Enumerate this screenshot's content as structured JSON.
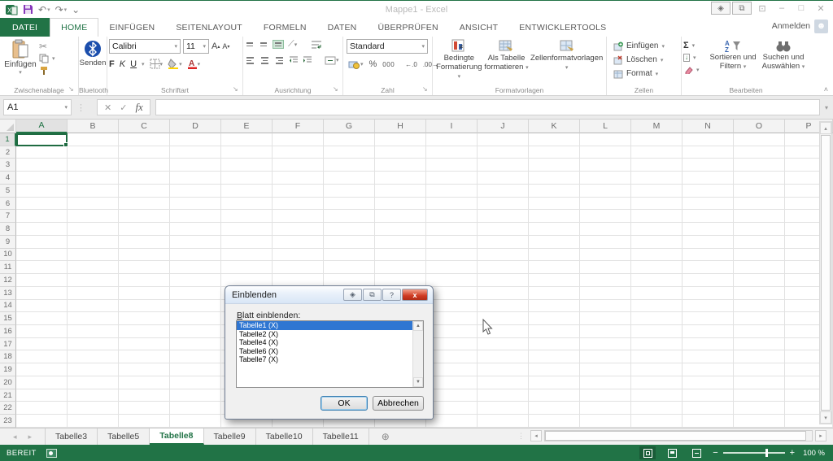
{
  "colors": {
    "excel_green": "#217346",
    "selection_blue": "#2f76d2",
    "close_red": "#cf3a22"
  },
  "window": {
    "title": "Mappe1 - Excel",
    "signin_label": "Anmelden",
    "minimize": "–",
    "maximize": "□",
    "close": "✕",
    "overlay1": "◈",
    "overlay2": "⧉",
    "ribbon_display": "⊡"
  },
  "quick_access": {
    "undo": "↶",
    "redo": "↷",
    "dropdown": "▾",
    "customize": "⌄"
  },
  "ribbon_tabs": [
    {
      "label": "DATEI",
      "type": "file"
    },
    {
      "label": "HOME",
      "type": "active"
    },
    {
      "label": "EINFÜGEN",
      "type": "normal"
    },
    {
      "label": "SEITENLAYOUT",
      "type": "normal"
    },
    {
      "label": "FORMELN",
      "type": "normal"
    },
    {
      "label": "DATEN",
      "type": "normal"
    },
    {
      "label": "ÜBERPRÜFEN",
      "type": "normal"
    },
    {
      "label": "ANSICHT",
      "type": "normal"
    },
    {
      "label": "ENTWICKLERTOOLS",
      "type": "normal"
    }
  ],
  "ribbon": {
    "clipboard": {
      "paste": "Einfügen",
      "group": "Zwischenablage",
      "cut_icon": "✂"
    },
    "bluetooth": {
      "send": "Senden",
      "group": "Bluetooth"
    },
    "font": {
      "family": "Calibri",
      "size": "11",
      "bold": "F",
      "italic": "K",
      "underline": "U",
      "grow": "A",
      "shrink": "A",
      "group": "Schriftart"
    },
    "alignment": {
      "group": "Ausrichtung"
    },
    "number": {
      "format": "Standard",
      "percent": "%",
      "thousands": "000",
      "group": "Zahl"
    },
    "styles": {
      "conditional": "Bedingte Formatierung",
      "as_table": "Als Tabelle formatieren",
      "cell_styles": "Zellenformatvorlagen",
      "group": "Formatvorlagen"
    },
    "cells": {
      "insert": "Einfügen",
      "delete": "Löschen",
      "format": "Format",
      "group": "Zellen"
    },
    "editing": {
      "autosum": "Σ",
      "fill": "↓",
      "sort": "Sortieren und Filtern",
      "find": "Suchen und Auswählen",
      "group": "Bearbeiten"
    },
    "collapse": "˄"
  },
  "formula_bar": {
    "name_box": "A1",
    "cancel": "✕",
    "enter": "✓",
    "fx": "fx",
    "value": "",
    "expand": "▾"
  },
  "grid": {
    "columns": [
      "A",
      "B",
      "C",
      "D",
      "E",
      "F",
      "G",
      "H",
      "I",
      "J",
      "K",
      "L",
      "M",
      "N",
      "O",
      "P"
    ],
    "rows": [
      1,
      2,
      3,
      4,
      5,
      6,
      7,
      8,
      9,
      10,
      11,
      12,
      13,
      14,
      15,
      16,
      17,
      18,
      19,
      20,
      21,
      22,
      23
    ],
    "selected_column": "A",
    "selected_row": 1
  },
  "dialog": {
    "title": "Einblenden",
    "label_prefix": "B",
    "label_rest": "latt einblenden:",
    "items": [
      "Tabelle1 (X)",
      "Tabelle2 (X)",
      "Tabelle4 (X)",
      "Tabelle6 (X)",
      "Tabelle7 (X)"
    ],
    "selected_index": 0,
    "ok": "OK",
    "cancel": "Abbrechen",
    "help": "?",
    "close": "x"
  },
  "sheet_bar": {
    "tabs": [
      "Tabelle3",
      "Tabelle5",
      "Tabelle8",
      "Tabelle9",
      "Tabelle10",
      "Tabelle11"
    ],
    "active_tab": "Tabelle8",
    "prev": "◂",
    "next": "▸",
    "add": "⊕"
  },
  "status_bar": {
    "mode": "BEREIT",
    "zoom_out": "−",
    "zoom_in": "+",
    "zoom_level": "100 %"
  }
}
